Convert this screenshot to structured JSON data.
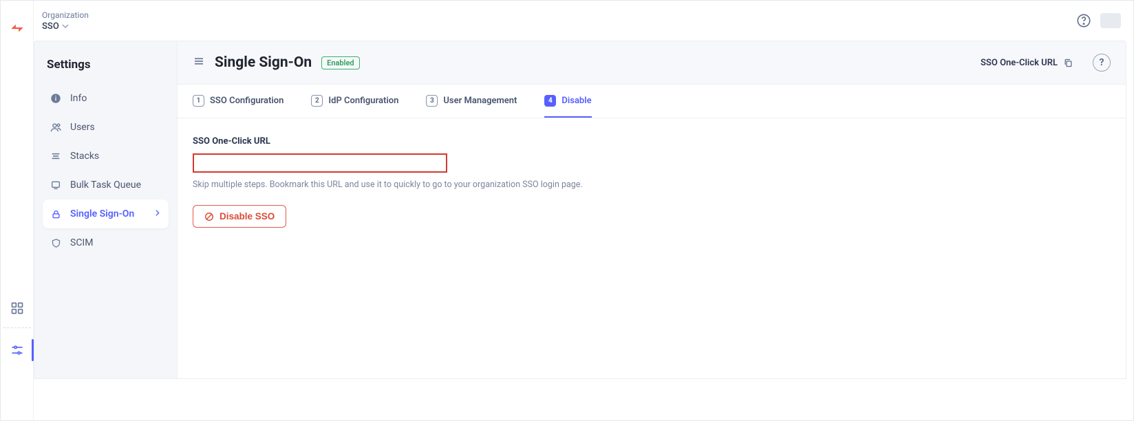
{
  "breadcrumb": {
    "super": "Organization",
    "current": "SSO"
  },
  "sidebar": {
    "title": "Settings",
    "items": [
      {
        "label": "Info"
      },
      {
        "label": "Users"
      },
      {
        "label": "Stacks"
      },
      {
        "label": "Bulk Task Queue"
      },
      {
        "label": "Single Sign-On"
      },
      {
        "label": "SCIM"
      }
    ]
  },
  "page": {
    "title": "Single Sign-On",
    "badge": "Enabled",
    "action_link": "SSO One-Click URL"
  },
  "tabs": [
    {
      "num": "1",
      "label": "SSO Configuration"
    },
    {
      "num": "2",
      "label": "IdP Configuration"
    },
    {
      "num": "3",
      "label": "User Management"
    },
    {
      "num": "4",
      "label": "Disable"
    }
  ],
  "panel": {
    "field_label": "SSO One-Click URL",
    "help_text": "Skip multiple steps. Bookmark this URL and use it to quickly to go to your organization SSO login page.",
    "disable_button": "Disable SSO"
  }
}
